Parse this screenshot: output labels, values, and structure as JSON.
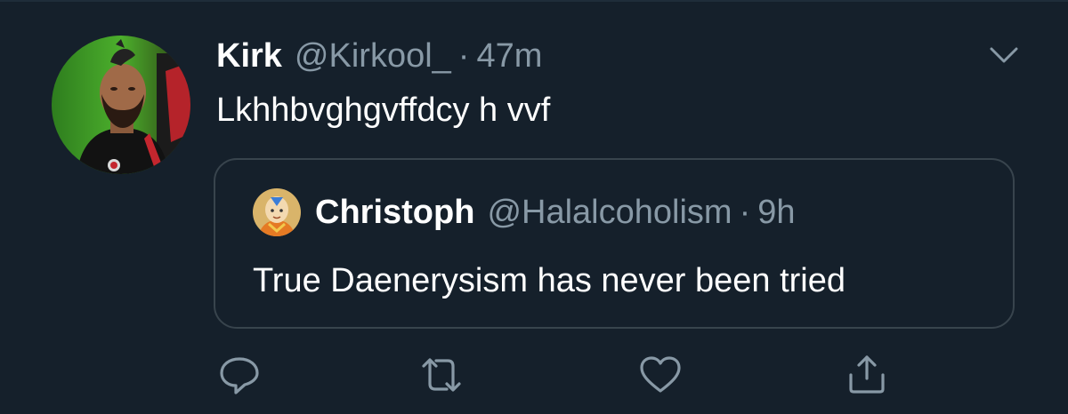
{
  "tweet": {
    "display_name": "Kirk",
    "handle": "@Kirkool_",
    "separator": "·",
    "time": "47m",
    "text": "Lkhhbvghgvffdcy h vvf"
  },
  "quoted_tweet": {
    "display_name": "Christoph",
    "handle": "@Halalcoholism",
    "separator": "·",
    "time": "9h",
    "text": "True Daenerysism has never been tried"
  },
  "actions": {
    "reply_icon": "reply-icon",
    "retweet_icon": "retweet-icon",
    "like_icon": "heart-icon",
    "share_icon": "share-icon"
  },
  "colors": {
    "background": "#15202b",
    "secondary_text": "#8899a6",
    "border": "#38444d",
    "primary_text": "#ffffff"
  }
}
